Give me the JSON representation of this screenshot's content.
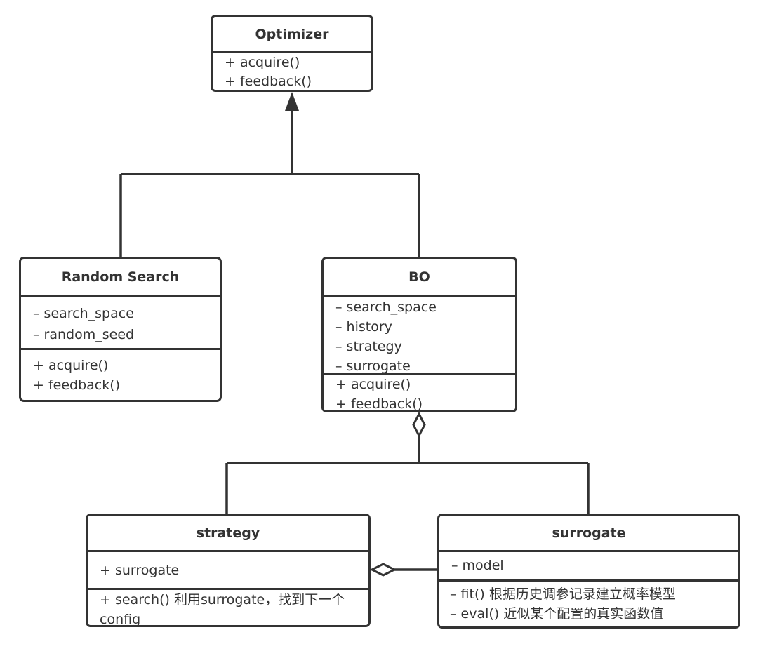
{
  "diagram": {
    "type": "UML class diagram",
    "classes": {
      "optimizer": {
        "name": "Optimizer",
        "attributes": [],
        "methods": [
          "+ acquire()",
          "+ feedback()"
        ]
      },
      "random_search": {
        "name": "Random Search",
        "attributes": [
          "– search_space",
          "– random_seed"
        ],
        "methods": [
          "+ acquire()",
          "+ feedback()"
        ]
      },
      "bo": {
        "name": "BO",
        "attributes": [
          "– search_space",
          "– history",
          "– strategy",
          "– surrogate"
        ],
        "methods": [
          "+ acquire()",
          "+ feedback()"
        ]
      },
      "strategy": {
        "name": "strategy",
        "attributes": [
          "+ surrogate"
        ],
        "methods": [
          "+ search() 利用surrogate，找到下一个config"
        ]
      },
      "surrogate": {
        "name": "surrogate",
        "attributes": [
          "– model"
        ],
        "methods": [
          "– fit() 根据历史调参记录建立概率模型",
          "– eval() 近似某个配置的真实函数值"
        ]
      }
    },
    "relationships": [
      {
        "type": "generalization",
        "from": "Random Search",
        "to": "Optimizer"
      },
      {
        "type": "generalization",
        "from": "BO",
        "to": "Optimizer"
      },
      {
        "type": "aggregation",
        "whole": "BO",
        "part": "strategy"
      },
      {
        "type": "aggregation",
        "whole": "BO",
        "part": "surrogate"
      },
      {
        "type": "aggregation",
        "whole": "strategy",
        "part": "surrogate"
      }
    ],
    "colors": {
      "stroke": "#333333",
      "fill": "#ffffff",
      "text": "#333333"
    }
  }
}
